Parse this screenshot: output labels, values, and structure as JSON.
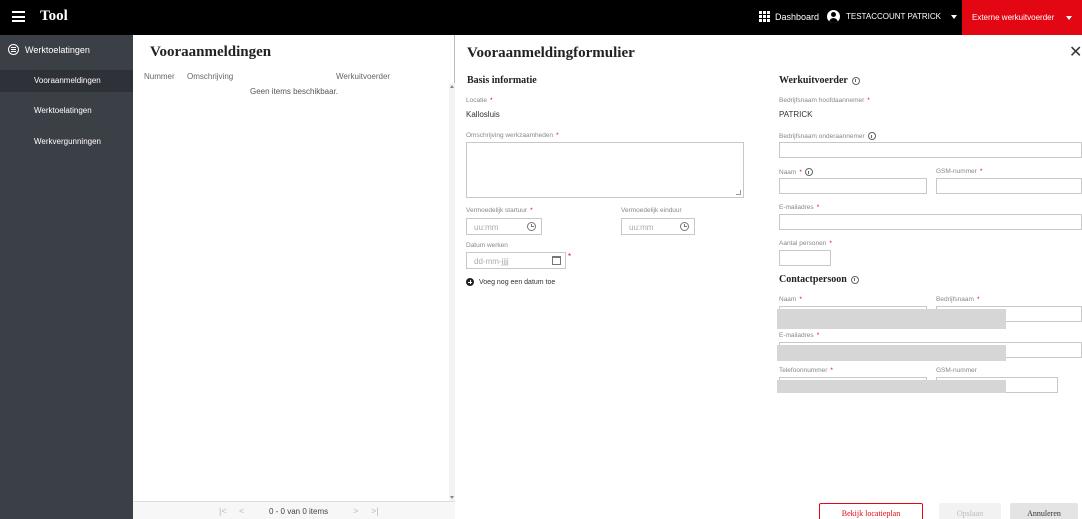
{
  "app": {
    "title": "Tool"
  },
  "topbar": {
    "dashboard_label": "Dashboard",
    "account_label": "TESTACCOUNT PATRICK",
    "role_label": "Externe werkuitvoerder",
    "role_color": "#e30613"
  },
  "sidebar": {
    "section_label": "Werktoelatingen",
    "items": [
      {
        "label": "Vooraanmeldingen",
        "active": true
      },
      {
        "label": "Werktoelatingen",
        "active": false
      },
      {
        "label": "Werkvergunningen",
        "active": false
      }
    ]
  },
  "list": {
    "title": "Vooraanmeldingen",
    "columns": [
      "Nummer",
      "Omschrijving",
      "Werkuitvoerder"
    ],
    "empty_text": "Geen items beschikbaar.",
    "pager_text": "0 - 0 van 0 items"
  },
  "form": {
    "title": "Vooraanmeldingformulier",
    "basis": {
      "title": "Basis informatie",
      "locatie_label": "Locatie",
      "locatie_value": "Kallosluis",
      "omschrijving_label": "Omschrijving werkzaamheden",
      "start_label": "Vermoedelijk startuur",
      "start_placeholder": "uu:mm",
      "end_label": "Vermoedelijk einduur",
      "end_placeholder": "uu:mm",
      "datum_label": "Datum werken",
      "datum_placeholder": "dd-mm-jjjj",
      "add_date_label": "Voeg nog een datum toe"
    },
    "werkuitvoerder": {
      "title": "Werkuitvoerder",
      "hoofd_label": "Bedrijfsnaam hoofdaannemer",
      "hoofd_value": "PATRICK",
      "onder_label": "Bedrijfsnaam onderaannemer",
      "naam_label": "Naam",
      "gsm_label": "GSM-nummer",
      "email_label": "E-mailadres",
      "aantal_label": "Aantal personen"
    },
    "contact": {
      "title": "Contactpersoon",
      "naam_label": "Naam",
      "bedrijf_label": "Bedrijfsnaam",
      "email_label": "E-mailadres",
      "telefoon_label": "Telefoonnummer",
      "gsm_label": "GSM-nummer"
    },
    "buttons": {
      "locatieplan": "Bekijk locatieplan",
      "opslaan": "Opslaan",
      "annuleren": "Annuleren"
    }
  }
}
